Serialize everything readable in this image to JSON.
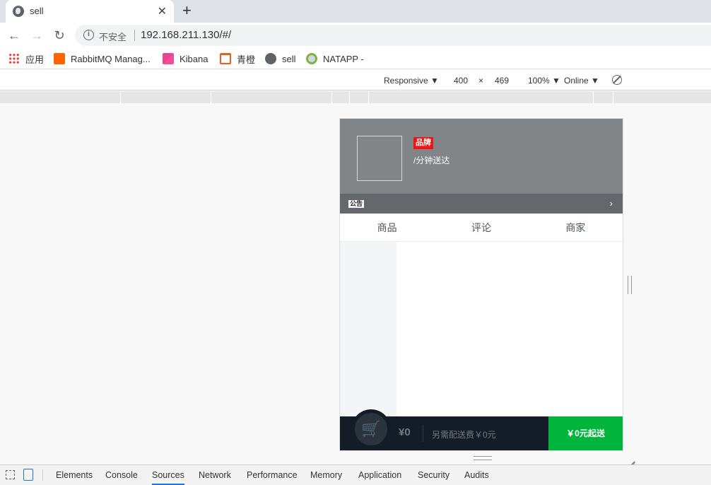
{
  "browser": {
    "tab_title": "sell",
    "tab_close": "✕",
    "new_tab": "+",
    "security_label": "不安全",
    "url": "192.168.211.130/#/"
  },
  "bookmarks": [
    {
      "label": "应用",
      "icon": "apps-icon"
    },
    {
      "label": "RabbitMQ Manag...",
      "icon": "rabbitmq-icon"
    },
    {
      "label": "Kibana",
      "icon": "kibana-icon"
    },
    {
      "label": "青橙",
      "icon": "qingcheng-icon"
    },
    {
      "label": "sell",
      "icon": "globe-icon"
    },
    {
      "label": "NATAPP -",
      "icon": "natapp-icon"
    }
  ],
  "device_toolbar": {
    "mode": "Responsive ▼",
    "width": "400",
    "times": "×",
    "height": "469",
    "zoom": "100% ▼",
    "network": "Online ▼"
  },
  "app": {
    "brand_badge": "品牌",
    "delivery_text": "/分钟送达",
    "bulletin_tag": "公告",
    "bulletin_arrow": "›",
    "tabs": [
      "商品",
      "评论",
      "商家"
    ],
    "cart": {
      "price": "¥0",
      "delivery_fee": "另需配送费￥0元",
      "min_order": "￥0元起送",
      "cart_icon": "cart-icon"
    },
    "colors": {
      "header_bg": "#818588",
      "brand_red": "#f01414",
      "cart_bg": "#141d27",
      "pay_green": "#00b43c"
    }
  },
  "devtools_tabs": [
    "Elements",
    "Console",
    "Sources",
    "Network",
    "Performance",
    "Memory",
    "Application",
    "Security",
    "Audits"
  ],
  "devtools_active_tab": "Sources"
}
